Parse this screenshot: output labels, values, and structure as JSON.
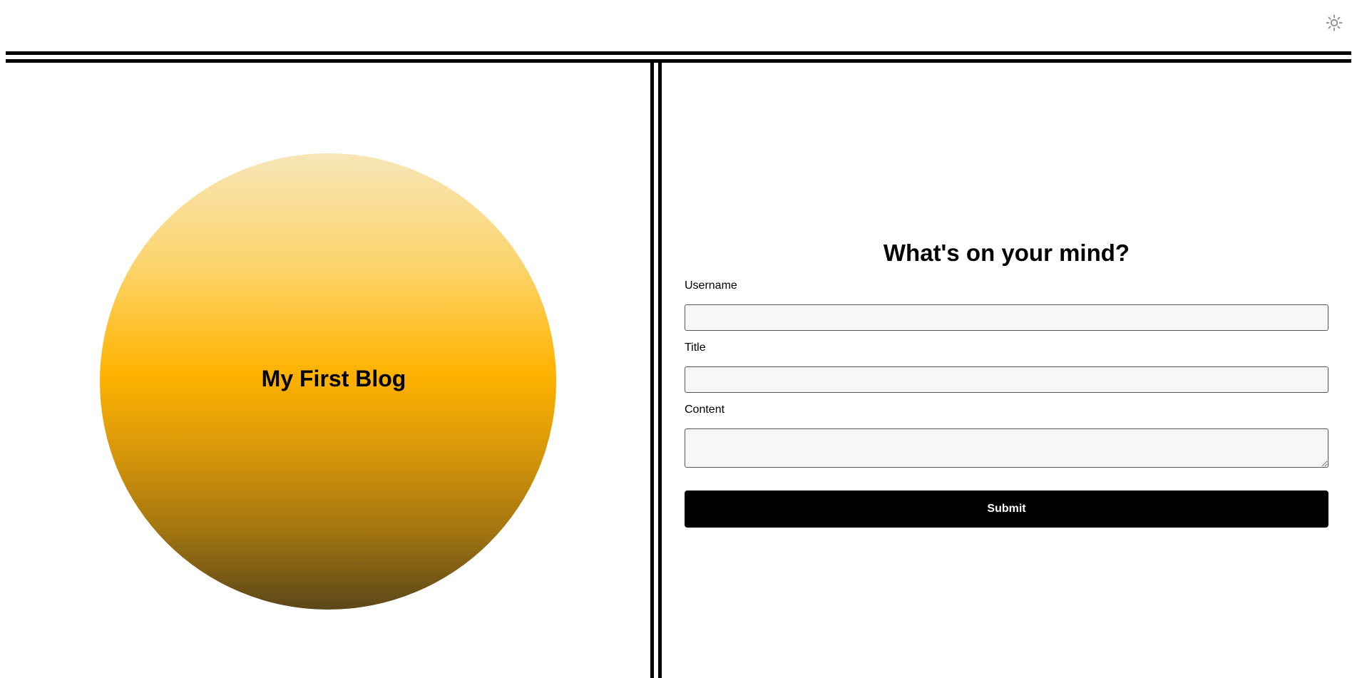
{
  "header": {
    "theme_toggle_icon": "sun-icon"
  },
  "hero": {
    "title": "My First Blog",
    "gradient_colors": [
      "#f8e6b8",
      "#fcd46b",
      "#ffb300",
      "#d6960a",
      "#a57710",
      "#5c4718"
    ]
  },
  "form": {
    "heading": "What's on your mind?",
    "username_label": "Username",
    "username_value": "",
    "title_label": "Title",
    "title_value": "",
    "content_label": "Content",
    "content_value": "",
    "submit_label": "Submit"
  },
  "colors": {
    "accent": "#000000",
    "input_background": "#f6f7f9"
  }
}
